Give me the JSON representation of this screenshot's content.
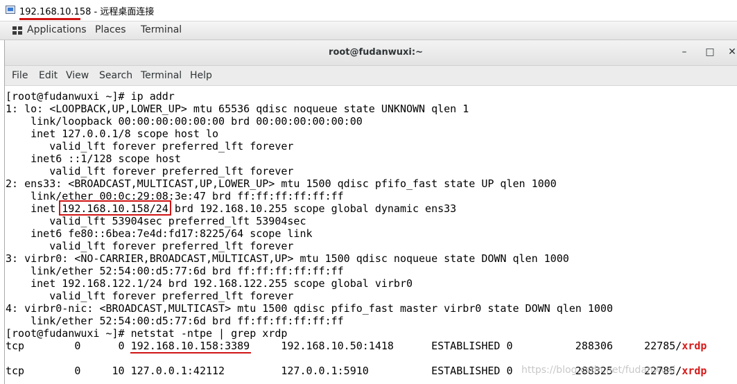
{
  "rdp": {
    "title_ip": "192.168.10.158",
    "title_suffix": " - 远程桌面连接"
  },
  "gnome": {
    "applications": "Applications",
    "places": "Places",
    "terminal": "Terminal"
  },
  "window": {
    "title": "root@fudanwuxi:~",
    "minimize": "–",
    "maximize": "□",
    "close": "✕"
  },
  "menu": {
    "file": "File",
    "edit": "Edit",
    "view": "View",
    "search": "Search",
    "terminal": "Terminal",
    "help": "Help"
  },
  "terminal": {
    "lines": [
      "[root@fudanwuxi ~]# ip addr",
      "1: lo: <LOOPBACK,UP,LOWER_UP> mtu 65536 qdisc noqueue state UNKNOWN qlen 1",
      "    link/loopback 00:00:00:00:00:00 brd 00:00:00:00:00:00",
      "    inet 127.0.0.1/8 scope host lo",
      "       valid_lft forever preferred_lft forever",
      "    inet6 ::1/128 scope host",
      "       valid_lft forever preferred_lft forever",
      "2: ens33: <BROADCAST,MULTICAST,UP,LOWER_UP> mtu 1500 qdisc pfifo_fast state UP qlen 1000",
      "    link/ether 00:0c:29:08:3e:47 brd ff:ff:ff:ff:ff:ff",
      "    inet 192.168.10.158/24 brd 192.168.10.255 scope global dynamic ens33",
      "       valid_lft 53904sec preferred_lft 53904sec",
      "    inet6 fe80::6bea:7e4d:fd17:8225/64 scope link",
      "       valid_lft forever preferred_lft forever",
      "3: virbr0: <NO-CARRIER,BROADCAST,MULTICAST,UP> mtu 1500 qdisc noqueue state DOWN qlen 1000",
      "    link/ether 52:54:00:d5:77:6d brd ff:ff:ff:ff:ff:ff",
      "    inet 192.168.122.1/24 brd 192.168.122.255 scope global virbr0",
      "       valid_lft forever preferred_lft forever",
      "4: virbr0-nic: <BROADCAST,MULTICAST> mtu 1500 qdisc pfifo_fast master virbr0 state DOWN qlen 1000",
      "    link/ether 52:54:00:d5:77:6d brd ff:ff:ff:ff:ff:ff",
      "[root@fudanwuxi ~]# netstat -ntpe | grep xrdp"
    ],
    "netstat_rows": [
      {
        "prefix": "tcp        0      0 192.168.10.158:3389     192.168.10.50:1418      ESTABLISHED 0          288306     22785/",
        "proc": "xrdp"
      },
      {
        "prefix": "",
        "proc": ""
      },
      {
        "prefix": "tcp        0     10 127.0.0.1:42112         127.0.0.1:5910          ESTABLISHED 0          288325     22785/",
        "proc": "xrdp"
      }
    ]
  },
  "watermark": "https://blog.csdn.net/fudanwuxi",
  "colors": {
    "highlight": "#d01414",
    "proc_name": "#d41a1a"
  }
}
